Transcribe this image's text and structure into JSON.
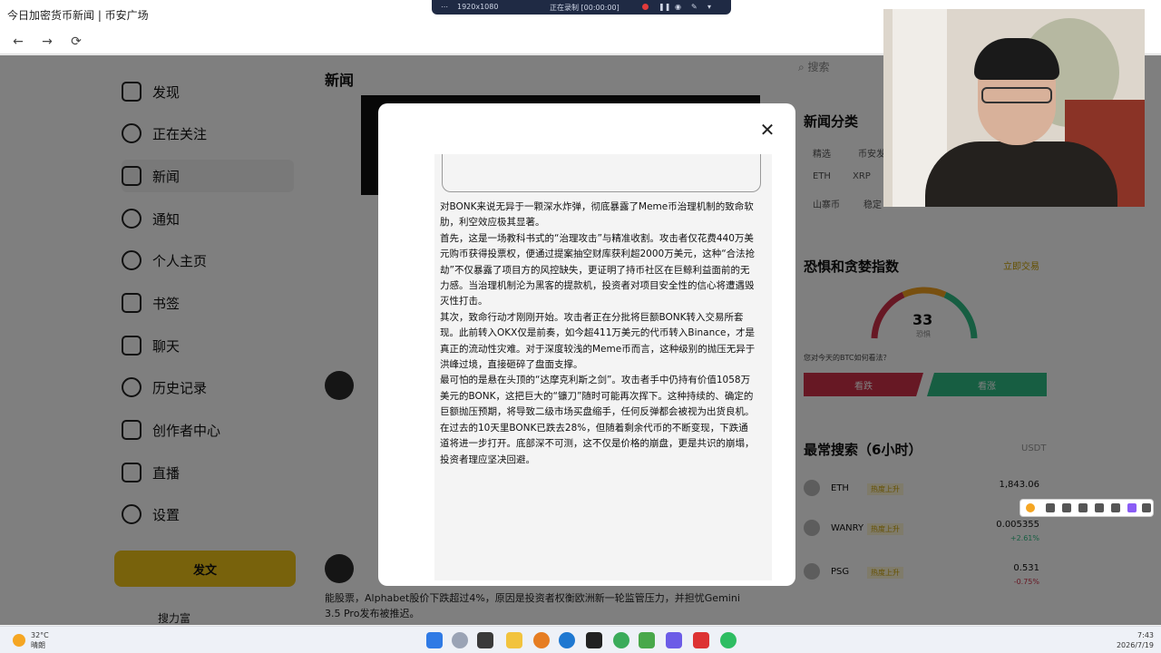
{
  "window": {
    "title": "今日加密货币新闻 | 币安广场"
  },
  "navbar": {
    "back": "←",
    "forward": "→",
    "reload": "⟳"
  },
  "recorder": {
    "resolution": "1920x1080",
    "status": "正在录制 [00:00:00]"
  },
  "sidebar": {
    "items": [
      {
        "label": "发现",
        "icon": "discover-icon"
      },
      {
        "label": "正在关注",
        "icon": "follow-icon"
      },
      {
        "label": "新闻",
        "icon": "news-icon",
        "active": true
      },
      {
        "label": "通知",
        "icon": "bell-icon"
      },
      {
        "label": "个人主页",
        "icon": "profile-icon"
      },
      {
        "label": "书签",
        "icon": "bookmark-icon"
      },
      {
        "label": "聊天",
        "icon": "mail-icon"
      },
      {
        "label": "历史记录",
        "icon": "history-icon"
      },
      {
        "label": "创作者中心",
        "icon": "creator-icon"
      },
      {
        "label": "直播",
        "icon": "live-icon"
      },
      {
        "label": "设置",
        "icon": "settings-icon"
      }
    ],
    "post_button": "发文",
    "user_name": "搜力富"
  },
  "news": {
    "heading": "新闻",
    "bottom_text": "能股票，Alphabet股价下跌超过4%，原因是投资者权衡欧洲新一轮监管压力，并担忧Gemini 3.5 Pro发布被推迟。"
  },
  "right": {
    "search_placeholder": "搜索",
    "categories_title": "新闻分类",
    "chips": [
      "精选",
      "币安发",
      "ETH",
      "XRP",
      "山寨币",
      "稳定"
    ],
    "fear_greed_title": "恐惧和贪婪指数",
    "fear_greed_link": "立即交易",
    "fear_greed_value": "33",
    "fear_greed_label": "恐惧",
    "vote_question": "您对今天的BTC如何看法？",
    "vote_bear": "看跌",
    "vote_bull": "看涨",
    "trending_title": "最常搜索（6小时）",
    "trending_unit": "USDT",
    "coins": [
      {
        "name": "ETH",
        "tag": "热度上升",
        "price": "1,843.06",
        "change": ""
      },
      {
        "name": "WANRY",
        "tag": "热度上升",
        "price": "0.005355",
        "change": "+2.61%"
      },
      {
        "name": "PSG",
        "tag": "热度上升",
        "price": "0.531",
        "change": "-0.75%"
      }
    ]
  },
  "modal": {
    "close": "✕",
    "paragraphs": [
      "对BONK来说无异于一颗深水炸弹，彻底暴露了Meme币治理机制的致命软肋，利空效应极其显著。",
      "首先，这是一场教科书式的“治理攻击”与精准收割。攻击者仅花费440万美元购币获得投票权，便通过提案抽空财库获利超2000万美元，这种“合法抢劫”不仅暴露了项目方的风控缺失，更证明了持币社区在巨鲸利益面前的无力感。当治理机制沦为黑客的提款机，投资者对项目安全性的信心将遭遇毁灭性打击。",
      "其次，致命行动才刚刚开始。攻击者正在分批将巨额BONK转入交易所套现。此前转入OKX仅是前奏，如今超411万美元的代币转入Binance，才是真正的流动性灾难。对于深度较浅的Meme币而言，这种级别的抛压无异于洪峰过境，直接砸碎了盘面支撑。",
      "最可怕的是悬在头顶的“达摩克利斯之剑”。攻击者手中仍持有价值1058万美元的BONK，这把巨大的“镰刀”随时可能再次挥下。这种持续的、确定的巨额抛压预期，将导致二级市场买盘缩手，任何反弹都会被视为出货良机。",
      "在过去的10天里BONK已跌去28%，但随着剩余代币的不断变现，下跌通道将进一步打开。底部深不可测，这不仅是价格的崩盘，更是共识的崩塌，投资者理应坚决回避。"
    ]
  },
  "taskbar": {
    "weather_temp": "32°C",
    "weather_desc": "晴朗",
    "time": "7:43",
    "date": "2026/7/19"
  }
}
